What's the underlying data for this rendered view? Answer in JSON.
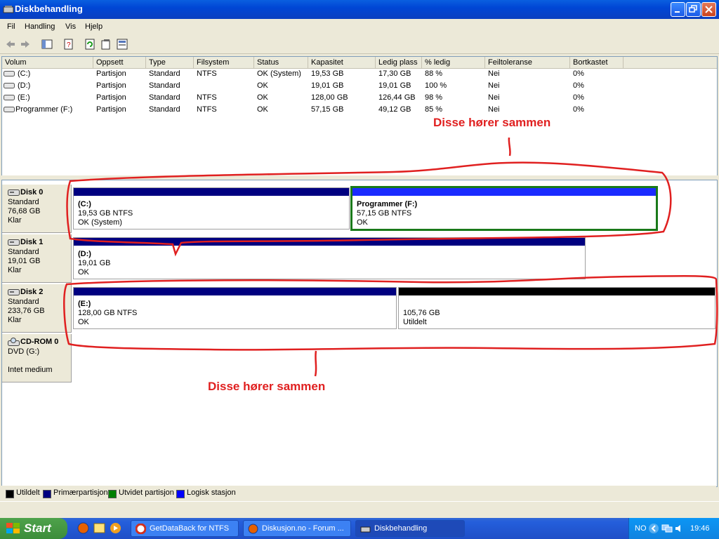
{
  "window": {
    "title": "Diskbehandling"
  },
  "menu": [
    "Fil",
    "Handling",
    "Vis",
    "Hjelp"
  ],
  "table": {
    "headers": [
      "Volum",
      "Oppsett",
      "Type",
      "Filsystem",
      "Status",
      "Kapasitet",
      "Ledig plass",
      "% ledig",
      "Feiltoleranse",
      "Bortkastet"
    ],
    "rows": [
      [
        "(C:)",
        "Partisjon",
        "Standard",
        "NTFS",
        "OK (System)",
        "19,53 GB",
        "17,30 GB",
        "88 %",
        "Nei",
        "0%"
      ],
      [
        "(D:)",
        "Partisjon",
        "Standard",
        "",
        "OK",
        "19,01 GB",
        "19,01 GB",
        "100 %",
        "Nei",
        "0%"
      ],
      [
        "(E:)",
        "Partisjon",
        "Standard",
        "NTFS",
        "OK",
        "128,00 GB",
        "126,44 GB",
        "98 %",
        "Nei",
        "0%"
      ],
      [
        "Programmer (F:)",
        "Partisjon",
        "Standard",
        "NTFS",
        "OK",
        "57,15 GB",
        "49,12 GB",
        "85 %",
        "Nei",
        "0%"
      ]
    ]
  },
  "disks": [
    {
      "name": "Disk 0",
      "type": "Standard",
      "size": "76,68 GB",
      "state": "Klar",
      "partitions": [
        {
          "label": "(C:)",
          "size": "19,53 GB NTFS",
          "status": "OK (System)"
        },
        {
          "label": "Programmer  (F:)",
          "size": "57,15 GB NTFS",
          "status": "OK"
        }
      ]
    },
    {
      "name": "Disk 1",
      "type": "Standard",
      "size": "19,01 GB",
      "state": "Klar",
      "partitions": [
        {
          "label": "(D:)",
          "size": "19,01 GB",
          "status": "OK"
        }
      ]
    },
    {
      "name": "Disk 2",
      "type": "Standard",
      "size": "233,76 GB",
      "state": "Klar",
      "partitions": [
        {
          "label": "(E:)",
          "size": "128,00 GB NTFS",
          "status": "OK"
        },
        {
          "label": "",
          "size": "105,76 GB",
          "status": "Utildelt"
        }
      ]
    },
    {
      "name": "CD-ROM 0",
      "type": "DVD (G:)",
      "size": "",
      "state": "Intet medium"
    }
  ],
  "legend": [
    "Utildelt",
    "Primærpartisjon",
    "Utvidet partisjon",
    "Logisk stasjon"
  ],
  "colors": {
    "unallocated": "#000000",
    "primary": "#000080",
    "extended": "#008000",
    "logical": "#0000ff",
    "annotation": "#e02020"
  },
  "annotations": {
    "top": "Disse hører sammen",
    "bottom": "Disse hører sammen"
  },
  "taskbar": {
    "start": "Start",
    "tasks": [
      "GetDataBack for NTFS",
      "Diskusjon.no - Forum ...",
      "Diskbehandling"
    ],
    "lang": "NO",
    "clock": "19:46"
  }
}
